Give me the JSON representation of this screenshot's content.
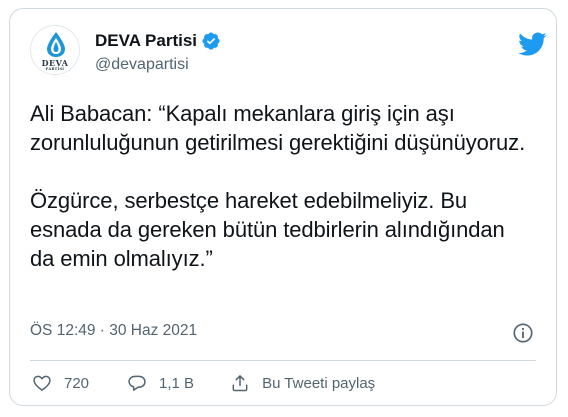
{
  "account": {
    "display_name": "DEVA Partisi",
    "handle": "@devapartisi",
    "logo_main": "DEVA",
    "logo_sub": "PARTİSİ"
  },
  "tweet": {
    "text": "Ali Babacan: “Kapalı mekanlara giriş için aşı zorunluluğunun getirilmesi gerektiğini düşünüyoruz.\n\nÖzgürce, serbestçe hareket edebilmeliyiz. Bu esnada da gereken bütün tedbirlerin alındığından da emin olmalıyız.”",
    "timestamp": "ÖS 12:49 · 30 Haz 2021"
  },
  "actions": {
    "like_count": "720",
    "reply_count": "1,1 B",
    "share_label": "Bu Tweeti paylaş"
  },
  "colors": {
    "twitter_blue": "#1d9bf0",
    "text_primary": "#0f1419",
    "text_secondary": "#536471",
    "border": "#cfd9de"
  },
  "icons": {
    "verified": "verified-badge-icon",
    "brand": "twitter-bird-icon",
    "info": "info-icon",
    "like": "heart-icon",
    "reply": "reply-bubble-icon",
    "share": "share-upload-icon"
  }
}
